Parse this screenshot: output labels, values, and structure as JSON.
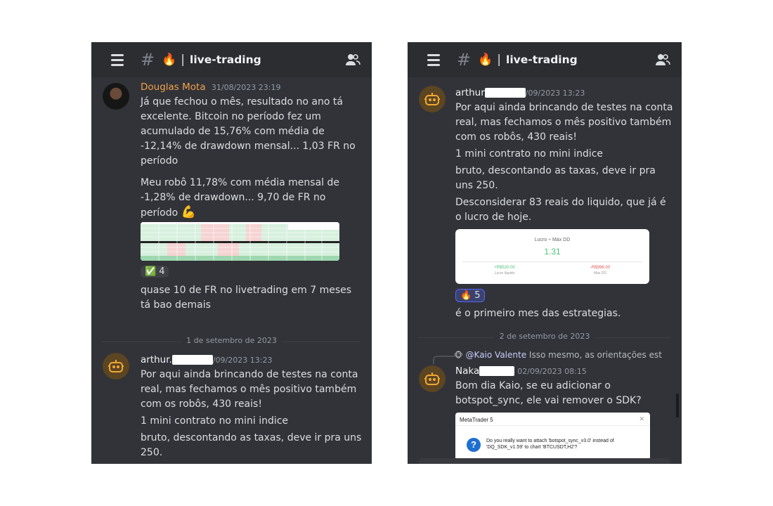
{
  "left": {
    "header": {
      "channel": "live-trading"
    },
    "msg1": {
      "author": "Douglas Mota",
      "timestamp": "31/08/2023 23:19",
      "p1": "Já que fechou o mês, resultado no ano tá excelente. Bitcoin no período fez um acumulado de 15,76% com média de -12,14% de drawdown mensal... 1,03 FR no período",
      "p2": "Meu robô 11,78% com média mensal de -1,28% de drawdown... 9,70 de FR no período",
      "p2_emoji": "💪",
      "reaction_emoji": "✅",
      "reaction_count": "4",
      "p3": "quase 10 de FR no livetrading em 7 meses tá bao demais"
    },
    "divider": "1 de setembro de 2023",
    "msg2": {
      "author": "arthur.",
      "timestamp": "/09/2023 13:23",
      "p1": "Por aqui ainda brincando de testes na conta real, mas fechamos o mês positivo também com os robôs, 430 reais!",
      "p2": "1 mini contrato no mini indice",
      "p3": "bruto, descontando as taxas, deve ir pra uns 250."
    }
  },
  "right": {
    "header": {
      "channel": "live-trading"
    },
    "msg1": {
      "author": "arthur",
      "timestamp": "/09/2023 13:23",
      "p1": "Por aqui ainda brincando de testes na conta real, mas fechamos o mês positivo também com os robôs, 430 reais!",
      "p2": "1 mini contrato no mini indice",
      "p3": "bruto, descontando as taxas, deve ir pra uns 250.",
      "p4": "Desconsiderar 83 reais do liquido, que já é o lucro de hoje.",
      "card": {
        "title": "Lucro ÷ Máx DD",
        "value": "1.31",
        "left_value": "+R$520.00",
        "left_label": "Lucro líquido",
        "right_value": "-R$396.00",
        "right_label": "Máx DD"
      },
      "reaction_emoji": "🔥",
      "reaction_count": "5",
      "p5": "é o primeiro mes das estrategias."
    },
    "divider": "2 de setembro de 2023",
    "msg2": {
      "reply_mention": "@Kaio Valente",
      "reply_text": "Isso mesmo, as orientações est",
      "author": "Naka",
      "timestamp": "02/09/2023 08:15",
      "p1": "Bom dia Kaio, se eu adicionar o botspot_sync, ele vai remover o SDK?",
      "dialog": {
        "title": "MetaTrader 5",
        "text": "Do you really want to attach 'botspot_sync_v3.0' instead of 'DQ_SDK_v1.59' to chart 'BTCUSDT,H2'?"
      }
    }
  },
  "colors": {
    "background": "#313338",
    "topbar": "#2b2d31",
    "author_orange": "#f0a04b",
    "mention": "#c9cdfb"
  }
}
